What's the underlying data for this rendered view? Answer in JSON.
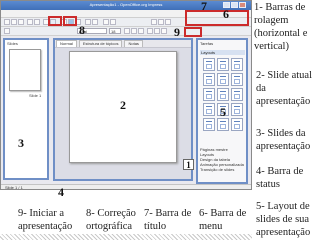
{
  "window": {
    "title": "Apresentação1 - OpenOffice.org Impress"
  },
  "menubar": {
    "items": [
      "Arquivo",
      "Editar",
      "Exibir",
      "Inserir",
      "Formatar",
      "Ferramentas",
      "Apresentação de slides",
      "Janela",
      "Ajuda"
    ]
  },
  "toolbar2": {
    "font_name": "Arial",
    "font_size": "18"
  },
  "slides_pane": {
    "title": "Slides",
    "slide_label": "Slide 1"
  },
  "editor": {
    "tabs": [
      "Normal",
      "Estrutura de tópicos",
      "Notas",
      "Folheto",
      "Classificador de slides"
    ]
  },
  "tasks_pane": {
    "title": "Tarefas",
    "section": "Layouts",
    "items": [
      "Páginas mestre",
      "Layouts",
      "Design da tabela",
      "Animação personalizada",
      "Transição de slides"
    ]
  },
  "statusbar": {
    "text": "Slide 1 / 1"
  },
  "markers": {
    "m1": "1",
    "m2": "2",
    "m3": "3",
    "m4": "4",
    "m5": "5",
    "m6": "6",
    "m7": "7",
    "m8": "8",
    "m9": "9"
  },
  "legend": {
    "l1": "1- Barras de rolagem (horizontal e vertical)",
    "l2": "2- Slide atual da apresentação",
    "l3": "3- Slides da apresentação",
    "l4": "4- Barra de status",
    "l5": "5- Layout de slides de sua apresentação",
    "l6": "6- Barra de menu",
    "l7": "7- Barra de título",
    "l8": "8- Correção ortográfica",
    "l9": "9- Iniciar a apresentação"
  },
  "colors": {
    "highlight": "#cc2b2b",
    "pane_border": "#6f8fc6",
    "titlebar": "#4a7cc4"
  }
}
